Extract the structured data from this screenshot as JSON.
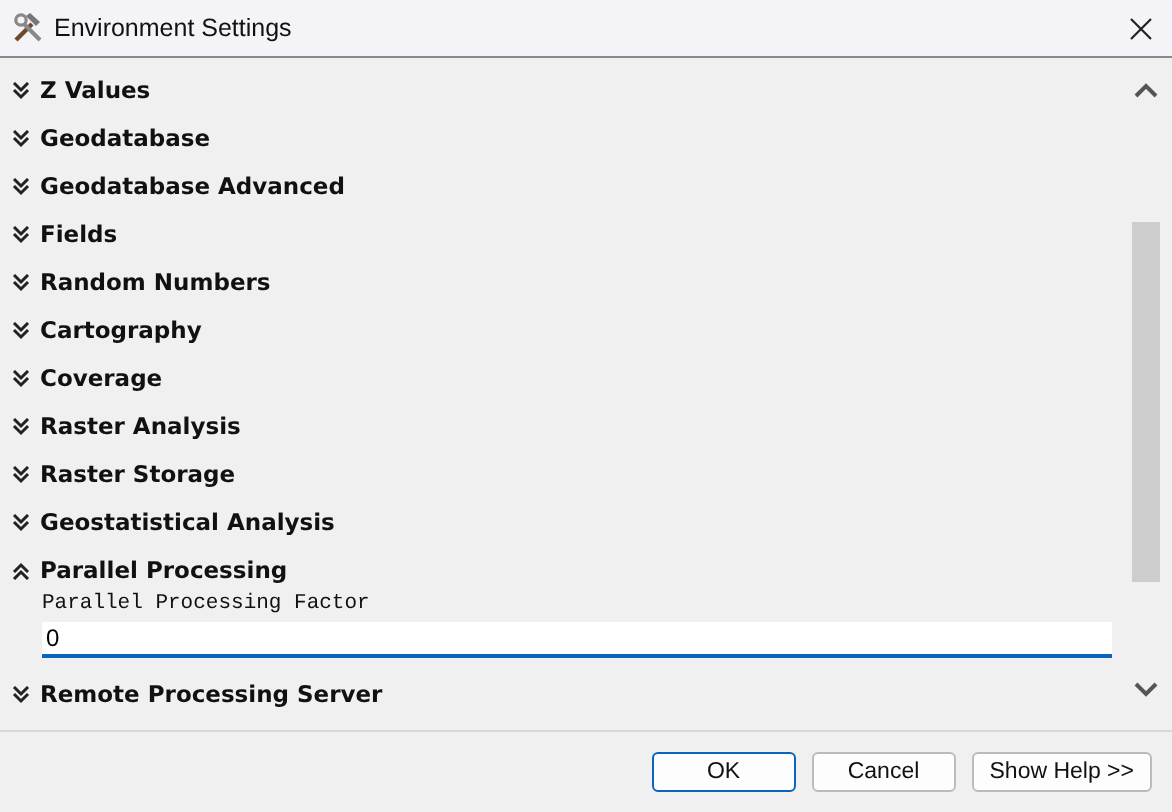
{
  "window": {
    "title": "Environment Settings"
  },
  "sections": [
    {
      "label": "Z Values",
      "expanded": false
    },
    {
      "label": "Geodatabase",
      "expanded": false
    },
    {
      "label": "Geodatabase Advanced",
      "expanded": false
    },
    {
      "label": "Fields",
      "expanded": false
    },
    {
      "label": "Random Numbers",
      "expanded": false
    },
    {
      "label": "Cartography",
      "expanded": false
    },
    {
      "label": "Coverage",
      "expanded": false
    },
    {
      "label": "Raster Analysis",
      "expanded": false
    },
    {
      "label": "Raster Storage",
      "expanded": false
    },
    {
      "label": "Geostatistical Analysis",
      "expanded": false
    },
    {
      "label": "Parallel Processing",
      "expanded": true,
      "fields": [
        {
          "label": "Parallel Processing Factor",
          "value": "0"
        }
      ]
    },
    {
      "label": "Remote Processing Server",
      "expanded": false
    }
  ],
  "buttons": [
    "OK",
    "Cancel",
    "Show Help >>"
  ]
}
